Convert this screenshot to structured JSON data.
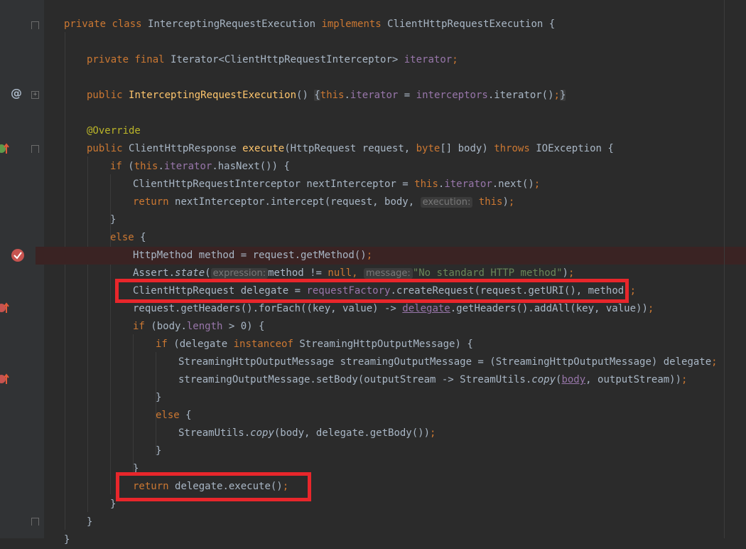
{
  "code": {
    "l1": {
      "kw1": "private ",
      "kw2": "class ",
      "name": "InterceptingRequestExecution ",
      "kw3": "implements ",
      "iface": "ClientHttpRequestExecution {"
    },
    "l3": {
      "kw1": "private ",
      "kw2": "final ",
      "type": "Iterator<ClientHttpRequestInterceptor> ",
      "field": "iterator",
      "semi": ";"
    },
    "l5": {
      "kw1": "public ",
      "ctor": "InterceptingRequestExecution",
      "paren": "() ",
      "ob": "{",
      "this": "this",
      "dot": ".",
      "field": "iterator",
      "eq": " = ",
      "src": "interceptors",
      "call": ".iterator()",
      "semi": ";",
      "cb": "}"
    },
    "l7": {
      "ann": "@Override"
    },
    "l8": {
      "kw1": "public ",
      "ret": "ClientHttpResponse ",
      "fn": "execute",
      "params1": "(HttpRequest request, ",
      "kw2": "byte",
      "params2": "[] body) ",
      "kw3": "throws ",
      "rest": "IOException {"
    },
    "l9": {
      "kw": "if ",
      "p1": "(",
      "this": "this",
      "dot": ".",
      "field": "iterator",
      "rest": ".hasNext()) {"
    },
    "l10": {
      "type": "ClientHttpRequestInterceptor nextInterceptor = ",
      "this": "this",
      "dot": ".",
      "field": "iterator",
      "rest": ".next()",
      "semi": ";"
    },
    "l11": {
      "kw": "return ",
      "rest": "nextInterceptor.intercept(request, body, ",
      "hint": "execution:",
      "this": "this",
      "close": ")",
      "semi": ";"
    },
    "l12": {
      "text": "}"
    },
    "l13": {
      "kw": "else ",
      "rest": "{"
    },
    "l14": {
      "text": "HttpMethod method = request.getMethod()",
      "semi": ";"
    },
    "l15": {
      "cls": "Assert.",
      "fn": "state",
      "p1": "(",
      "hint1": "expression:",
      "mid": "method != ",
      "kw": "null",
      "comma": ", ",
      "hint2": "message:",
      "str": "\"No standard HTTP method\"",
      "close": ")",
      "semi": ";"
    },
    "l16": {
      "text": "ClientHttpRequest delegate = ",
      "field": "requestFactory",
      "rest": ".createRequest(request.getURI(), method)",
      "semi": ";"
    },
    "l17": {
      "a": "request.getHeaders().forEach((key, value) -> ",
      "u": "delegate",
      "b": ".getHeaders().addAll(key, value))",
      "semi": ";"
    },
    "l18": {
      "kw": "if ",
      "a": "(body.",
      "field": "length",
      "b": " > 0) {"
    },
    "l19": {
      "kw": "if ",
      "a": "(delegate ",
      "kw2": "instanceof ",
      "b": "StreamingHttpOutputMessage) {"
    },
    "l20": {
      "text": "StreamingHttpOutputMessage streamingOutputMessage = (StreamingHttpOutputMessage) delegate",
      "semi": ";"
    },
    "l21": {
      "a": "streamingOutputMessage.setBody(outputStream -> StreamUtils.",
      "fn": "copy",
      "p": "(",
      "u": "body",
      "b": ", outputStream))",
      "semi": ";"
    },
    "l22": {
      "text": "}"
    },
    "l23": {
      "kw": "else ",
      "rest": "{"
    },
    "l24": {
      "a": "StreamUtils.",
      "fn": "copy",
      "b": "(body, delegate.getBody())",
      "semi": ";"
    },
    "l25": {
      "text": "}"
    },
    "l26": {
      "text": "}"
    },
    "l27": {
      "kw": "return ",
      "rest": "delegate.execute()",
      "semi": ";"
    },
    "l28": {
      "text": "}"
    },
    "l29": {
      "text": "}"
    },
    "l30": {
      "text": "}"
    }
  },
  "gutter": {
    "at_symbol": "@",
    "check": "✓",
    "fold_plus": "+"
  },
  "colors": {
    "keyword": "#cc7832",
    "field": "#9876aa",
    "method_decl": "#ffc66d",
    "annotation": "#bbb529",
    "string": "#6a8759",
    "text": "#a9b7c6",
    "highlight_box": "#e8262b",
    "breakpoint": "#c75450"
  }
}
